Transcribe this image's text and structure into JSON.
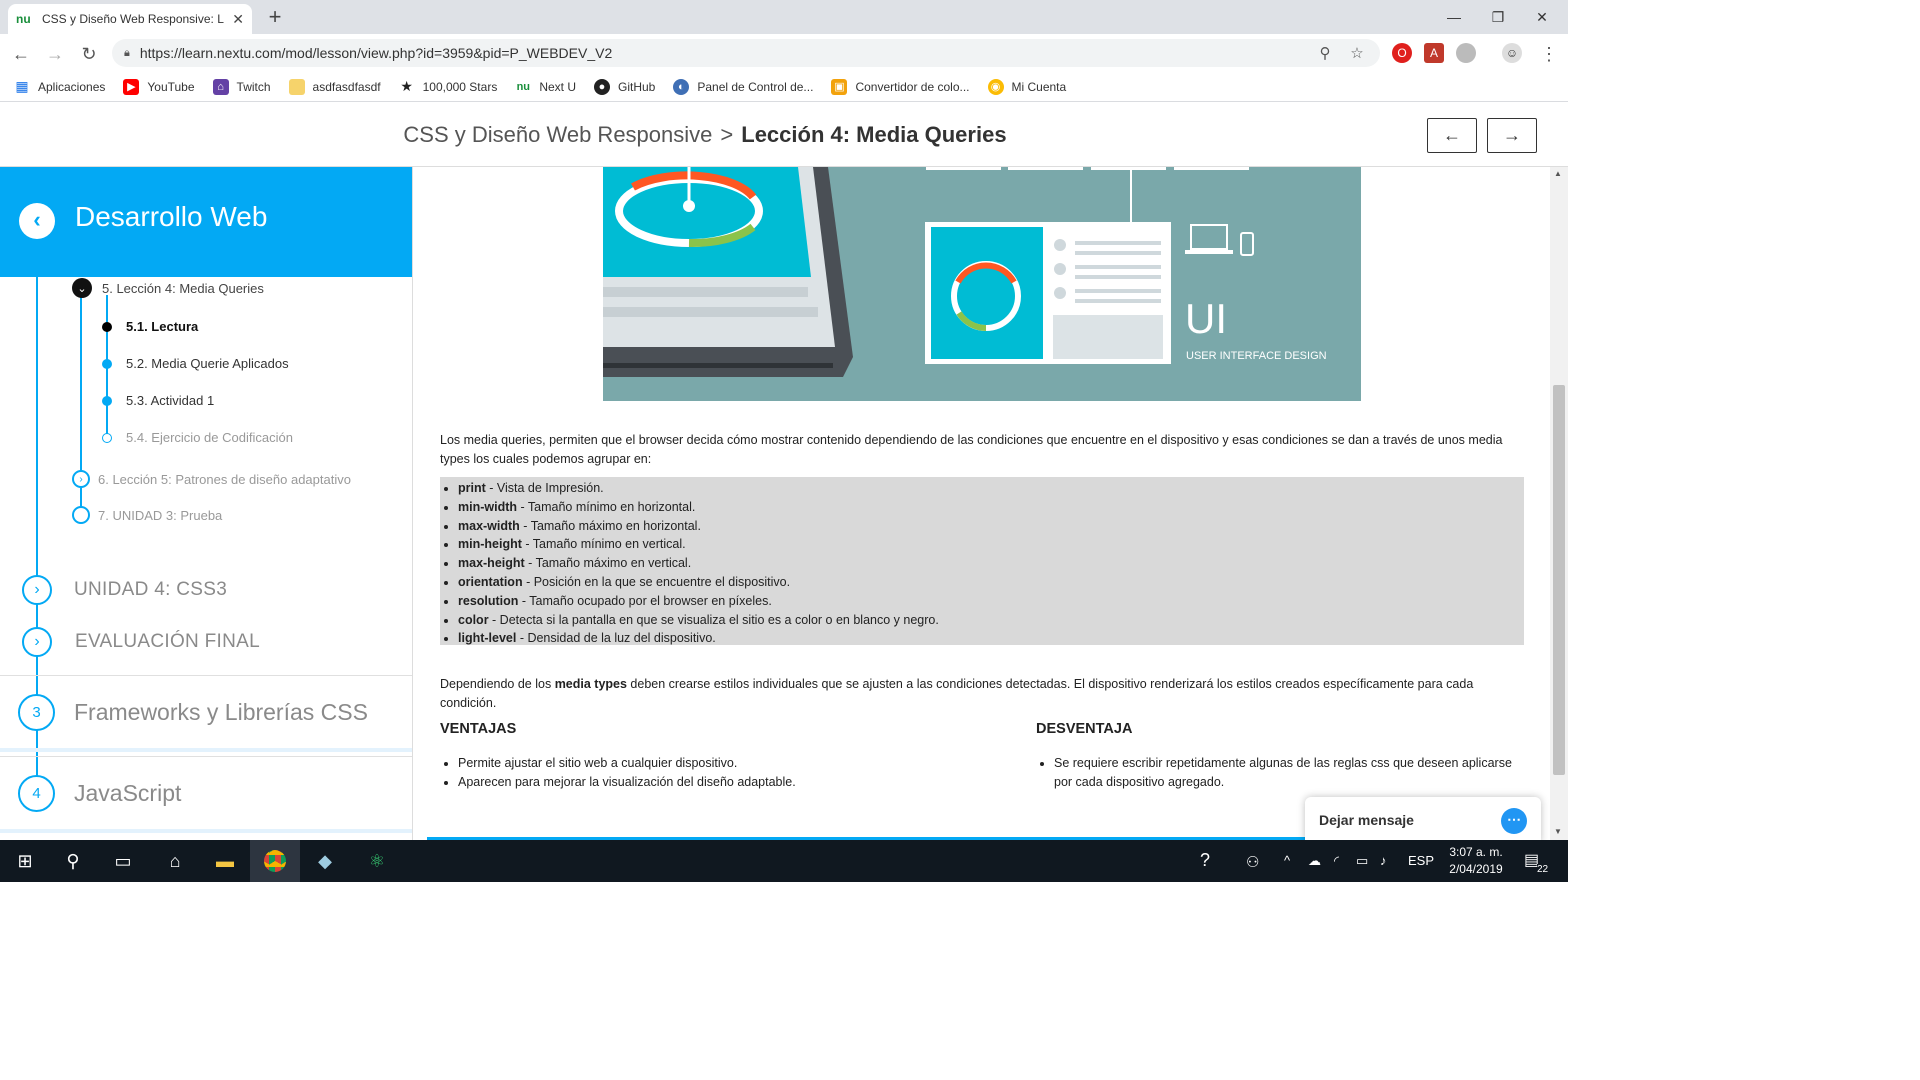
{
  "browser": {
    "tab_title": "CSS y Diseño Web Responsive: Le",
    "favicon": "nu",
    "url": "https://learn.nextu.com/mod/lesson/view.php?id=3959&pid=P_WEBDEV_V2",
    "bookmarks": [
      {
        "label": "Aplicaciones",
        "icon": "apps-grid-icon"
      },
      {
        "label": "YouTube",
        "icon": "youtube-icon"
      },
      {
        "label": "Twitch",
        "icon": "twitch-icon"
      },
      {
        "label": "asdfasdfasdf",
        "icon": "folder-icon"
      },
      {
        "label": "100,000 Stars",
        "icon": "star-icon"
      },
      {
        "label": "Next U",
        "icon": "nextu-icon"
      },
      {
        "label": "GitHub",
        "icon": "github-icon"
      },
      {
        "label": "Panel de Control de...",
        "icon": "panel-icon"
      },
      {
        "label": "Convertidor de colo...",
        "icon": "converter-icon"
      },
      {
        "label": "Mi Cuenta",
        "icon": "account-icon"
      }
    ]
  },
  "header": {
    "course": "CSS y Diseño Web Responsive",
    "separator": ">",
    "lesson": "Lección 4: Media Queries",
    "prev_symbol": "←",
    "next_symbol": "→"
  },
  "sidebar": {
    "title": "Desarrollo Web",
    "current_lesson": "5. Lección 4: Media Queries",
    "subitems": [
      {
        "label": "5.1. Lectura",
        "state": "current"
      },
      {
        "label": "5.2. Media Querie Aplicados",
        "state": "done"
      },
      {
        "label": "5.3. Actividad 1",
        "state": "done"
      },
      {
        "label": "5.4. Ejercicio de Codificación",
        "state": "pending"
      }
    ],
    "lessons": [
      {
        "label": "6. Lección 5: Patrones de diseño adaptativo"
      },
      {
        "label": "7. UNIDAD 3: Prueba"
      }
    ],
    "units": [
      {
        "label": "UNIDAD 4: CSS3"
      },
      {
        "label": "EVALUACIÓN FINAL"
      }
    ],
    "modules": [
      {
        "number": "3",
        "label": "Frameworks y Librerías CSS"
      },
      {
        "number": "4",
        "label": "JavaScript"
      }
    ]
  },
  "hero": {
    "big_text": "UI",
    "caption": "USER INTERFACE DESIGN"
  },
  "content": {
    "intro": "Los media queries, permiten que el browser decida cómo mostrar contenido dependiendo de las condiciones que encuentre en el dispositivo y esas condiciones se dan a través de unos media types los cuales podemos agrupar en:",
    "media_types": [
      {
        "term": "print",
        "desc": " - Vista de Impresión."
      },
      {
        "term": "min-width",
        "desc": " - Tamaño mínimo en horizontal."
      },
      {
        "term": "max-width",
        "desc": " - Tamaño máximo en horizontal."
      },
      {
        "term": "min-height",
        "desc": " - Tamaño mínimo en vertical."
      },
      {
        "term": "max-height",
        "desc": " - Tamaño máximo en vertical."
      },
      {
        "term": "orientation",
        "desc": " - Posición en la que se encuentre el dispositivo."
      },
      {
        "term": "resolution",
        "desc": " - Tamaño ocupado por el browser en píxeles."
      },
      {
        "term": "color",
        "desc": " - Detecta si la pantalla en que se visualiza el sitio es a color o en blanco y negro."
      },
      {
        "term": "light-level",
        "desc": " - Densidad de la luz del dispositivo."
      }
    ],
    "para2_pre": "Dependiendo de los ",
    "para2_bold": "media types",
    "para2_post": " deben crearse estilos individuales que se ajusten a las condiciones detectadas. El dispositivo renderizará los estilos creados específicamente para cada condición.",
    "ventajas_title": "VENTAJAS",
    "ventajas": [
      "Permite ajustar el sitio web a cualquier dispositivo.",
      "Aparecen para mejorar la visualización del diseño adaptable."
    ],
    "desventaja_title": "DESVENTAJA",
    "desventajas": [
      "Se requiere escribir repetidamente algunas de las reglas css que deseen aplicarse por cada dispositivo agregado."
    ]
  },
  "chat": {
    "label": "Dejar mensaje"
  },
  "taskbar": {
    "lang": "ESP",
    "time": "3:07 a. m.",
    "date": "2/04/2019",
    "notifications": "22"
  },
  "colors": {
    "accent": "#03a9f4",
    "hero_bg": "#7aa8aa",
    "list_bg": "#d9d9d9",
    "taskbar": "#101820"
  }
}
